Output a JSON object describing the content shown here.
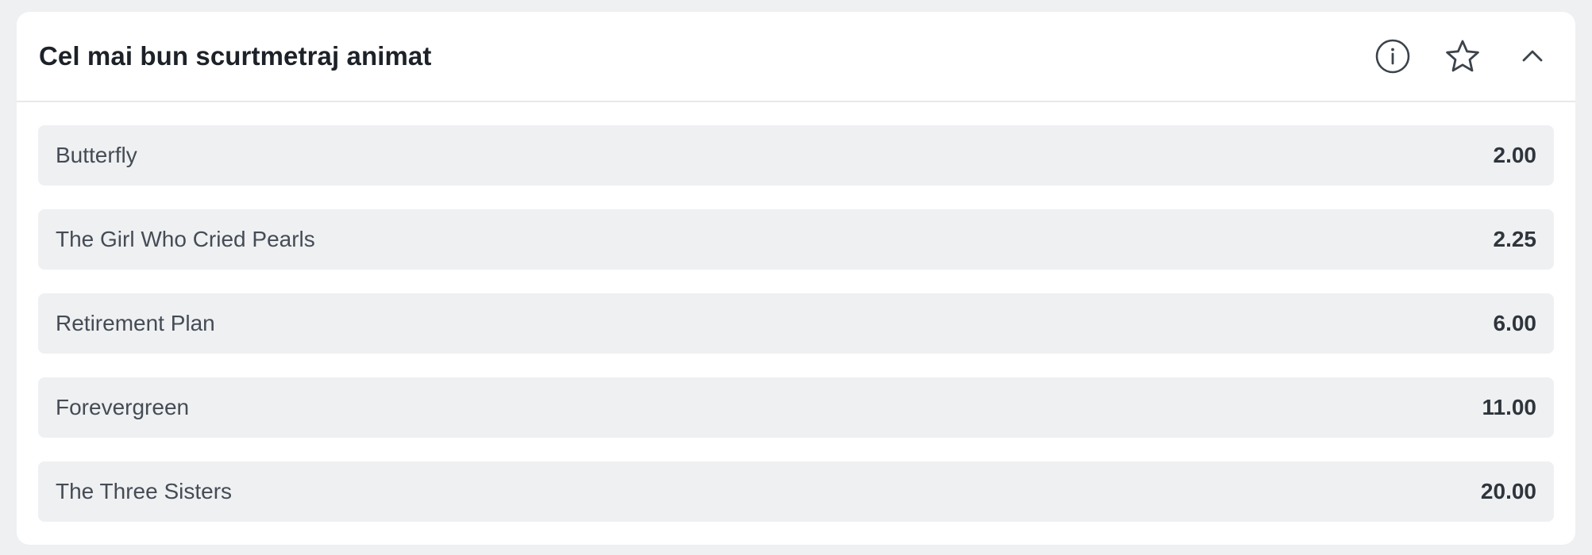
{
  "market": {
    "title": "Cel mai bun scurtmetraj animat",
    "icons": {
      "info": "info-icon",
      "favorite": "star-icon",
      "collapse": "chevron-up-icon"
    },
    "selections": [
      {
        "name": "Butterfly",
        "odds": "2.00"
      },
      {
        "name": "The Girl Who Cried Pearls",
        "odds": "2.25"
      },
      {
        "name": "Retirement Plan",
        "odds": "6.00"
      },
      {
        "name": "Forevergreen",
        "odds": "11.00"
      },
      {
        "name": "The Three Sisters",
        "odds": "20.00"
      }
    ]
  },
  "colors": {
    "page_background": "#eef0f2",
    "card_background": "#ffffff",
    "row_background": "#eff0f2",
    "title_text": "#1d2228",
    "icon_stroke": "#3c434b"
  }
}
